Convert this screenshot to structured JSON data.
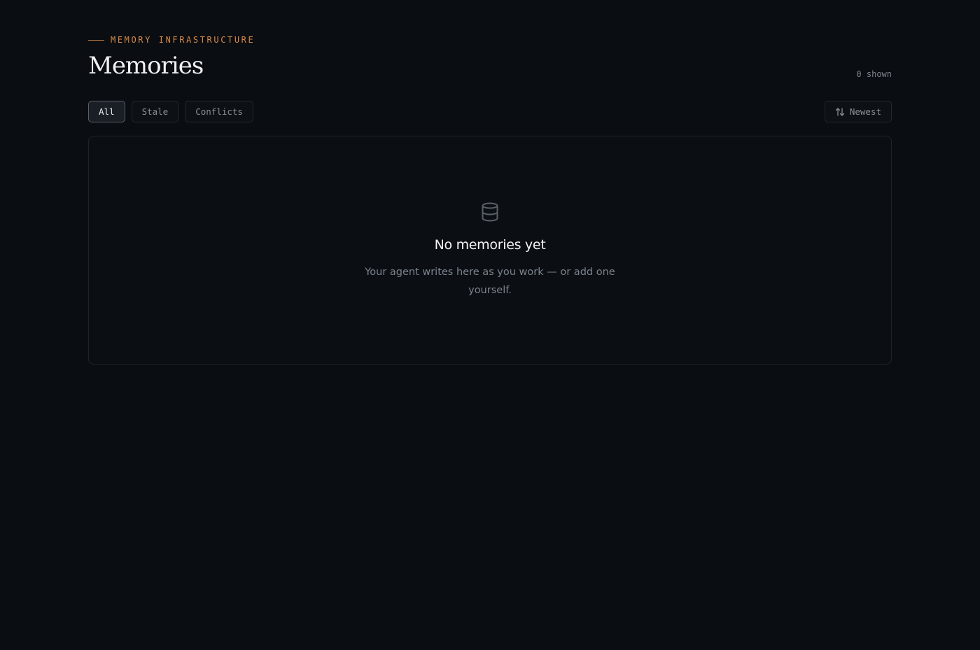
{
  "header": {
    "eyebrow": "MEMORY INFRASTRUCTURE",
    "title": "Memories",
    "count_label": "0 shown"
  },
  "filters": [
    {
      "label": "All",
      "active": true
    },
    {
      "label": "Stale",
      "active": false
    },
    {
      "label": "Conflicts",
      "active": false
    }
  ],
  "sort": {
    "icon": "sort-arrows-icon",
    "label": "Newest"
  },
  "empty_state": {
    "icon": "database-icon",
    "title": "No memories yet",
    "description": "Your agent writes here as you work — or add one yourself."
  },
  "colors": {
    "background": "#0a0d12",
    "accent": "#d98b45",
    "border": "#23282f",
    "muted_text": "#7b838c"
  }
}
